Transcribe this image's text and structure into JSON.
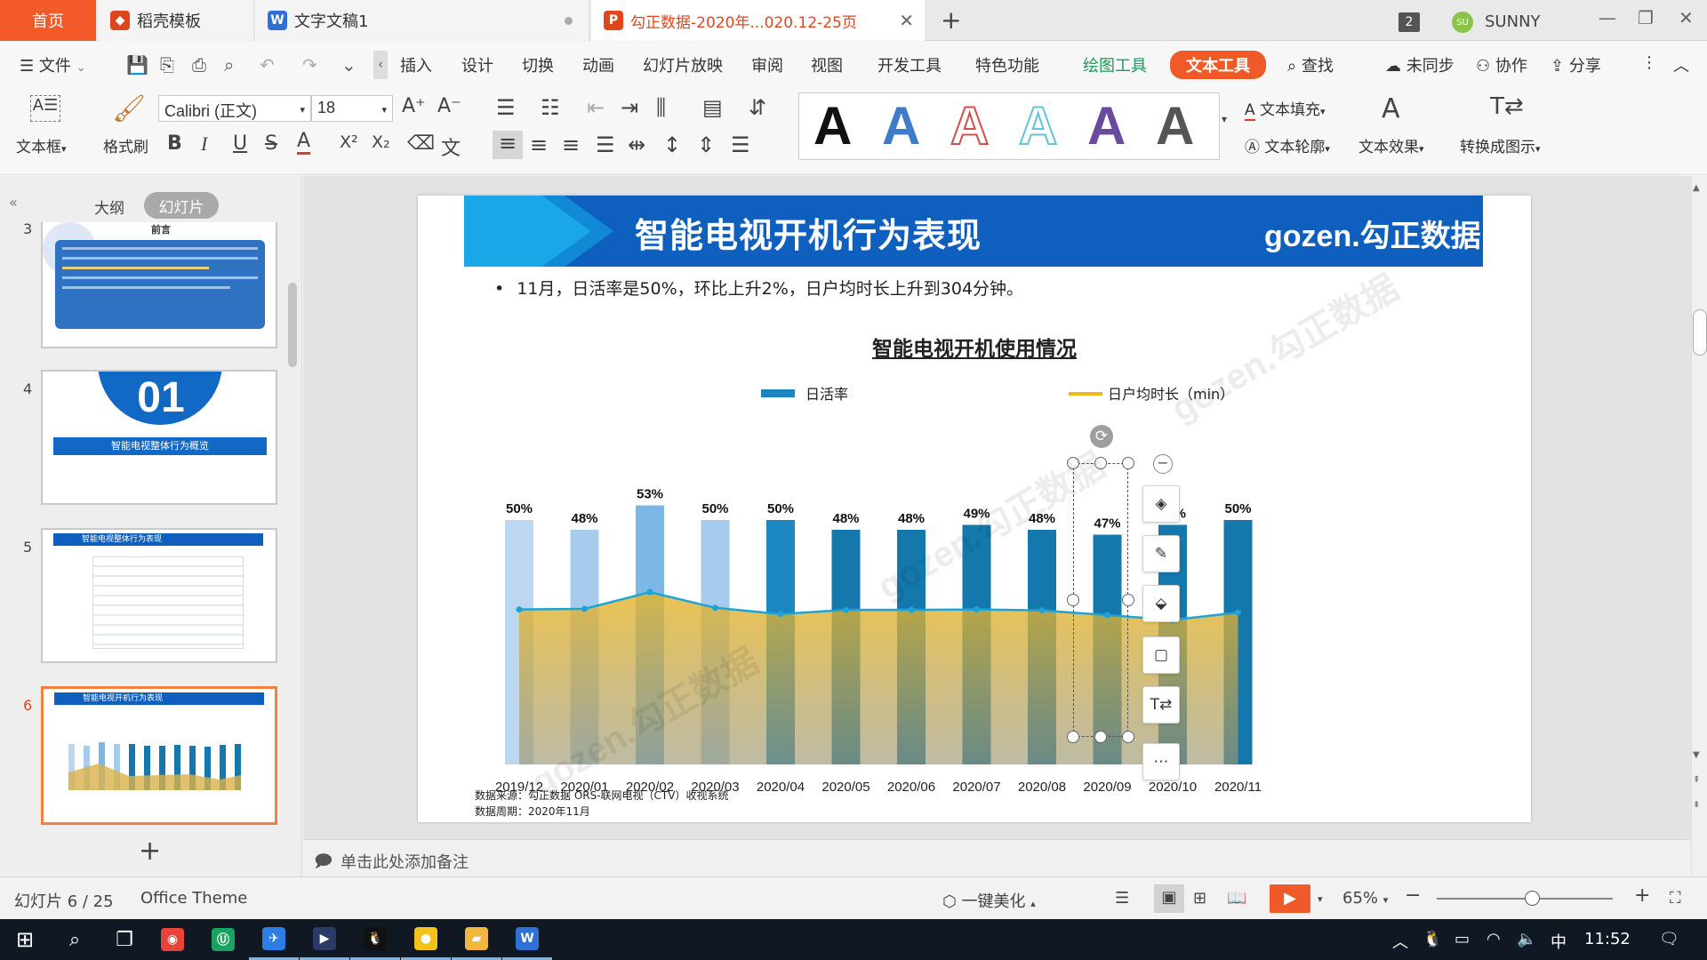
{
  "tabs": {
    "home": "首页",
    "items": [
      {
        "label": "稻壳模板",
        "icon": "daoke-icon",
        "color": "#e0461c"
      },
      {
        "label": "文字文稿1",
        "icon": "wps-writer-icon",
        "color": "#2f6fd6"
      },
      {
        "label": "勾正数据-2020年...020.12-25页",
        "icon": "wps-presentation-icon",
        "color": "#e0461c"
      }
    ],
    "new_tab": "+",
    "window_count": "2",
    "user_initials": "SU",
    "user_name": "SUNNY"
  },
  "menu": {
    "file": "文件",
    "items": [
      "插入",
      "设计",
      "切换",
      "动画",
      "幻灯片放映",
      "审阅",
      "视图",
      "开发工具",
      "特色功能"
    ],
    "drawing_tools": "绘图工具",
    "text_tools": "文本工具",
    "search": "查找",
    "unsynced": "未同步",
    "collaborate": "协作",
    "share": "分享"
  },
  "ribbon": {
    "textbox": "文本框",
    "format_painter": "格式刷",
    "font_name": "Calibri (正文)",
    "font_size": "18",
    "bold": "B",
    "italic": "I",
    "underline": "U",
    "strike": "S",
    "font_color": "A",
    "superscript": "X²",
    "subscript": "X₂",
    "text_fill": "文本填充",
    "text_outline": "文本轮廓",
    "text_effect": "文本效果",
    "convert_smartart": "转换成图示",
    "style_letter": "A",
    "style_colors": [
      "#111111",
      "#3d7cc8",
      "#d0504a",
      "#5fc6d6",
      "#6a4a9e",
      "#555555"
    ]
  },
  "left_panel": {
    "outline_tab": "大纲",
    "slides_tab": "幻灯片",
    "add_slide": "+",
    "thumbs": [
      {
        "num": "3",
        "title": "前言"
      },
      {
        "num": "4",
        "big": "01",
        "subtitle": "智能电视整体行为概览"
      },
      {
        "num": "5",
        "title": "智能电视整体行为表现"
      },
      {
        "num": "6",
        "title": "智能电视开机行为表现"
      }
    ]
  },
  "slide": {
    "title": "智能电视开机行为表现",
    "brand": "gozen.勾正数据",
    "bullet": "11月，日活率是50%，环比上升2%，日户均时长上升到304分钟。",
    "chart_title": "智能电视开机使用情况",
    "source_line1": "数据来源：勾正数据 ORS-联网电视（CTV）收视系统",
    "source_line2": "数据周期：2020年11月",
    "watermark": "gozen.勾正数据"
  },
  "chart_data": {
    "type": "bar",
    "title": "智能电视开机使用情况",
    "categories": [
      "2019/12",
      "2020/01",
      "2020/02",
      "2020/03",
      "2020/04",
      "2020/05",
      "2020/06",
      "2020/07",
      "2020/08",
      "2020/09",
      "2020/10",
      "2020/11"
    ],
    "series": [
      {
        "name": "日活率",
        "type": "bar",
        "values": [
          50,
          48,
          53,
          50,
          50,
          48,
          48,
          49,
          48,
          47,
          49,
          50
        ],
        "value_labels": [
          "50%",
          "48%",
          "53%",
          "50%",
          "50%",
          "48%",
          "48%",
          "49%",
          "48%",
          "47%",
          "49%",
          "50%"
        ]
      },
      {
        "name": "日户均时长（min）",
        "type": "area",
        "values": [
          296,
          297,
          329,
          299,
          287,
          295,
          295,
          296,
          294,
          285,
          276,
          290
        ]
      }
    ],
    "bar_colors": [
      "#bcd7ef",
      "#a7cbec",
      "#7db7e8",
      "#a7cbec",
      "#1c86c1",
      "#1578ad",
      "#1578ad",
      "#1578ad",
      "#1578ad",
      "#1578ad",
      "#1578ad",
      "#1578ad"
    ],
    "line_color": "#1ca3d8",
    "area_color": "#e8b526",
    "legend_position": "top",
    "bar_ylim": [
      0,
      60
    ],
    "area_ylim": [
      0,
      560
    ],
    "grid": false
  },
  "notes": {
    "placeholder": "单击此处添加备注"
  },
  "status": {
    "slide_info": "幻灯片 6 / 25",
    "theme": "Office Theme",
    "beautify": "一键美化",
    "zoom": "65%",
    "zoom_fraction": 0.54
  },
  "taskbar": {
    "time": "11:52",
    "ime": "中",
    "apps": [
      {
        "name": "chrome-icon",
        "color": "#e84337"
      },
      {
        "name": "green-app-icon",
        "color": "#1aa260"
      },
      {
        "name": "feishu-icon",
        "color": "#2f7de1"
      },
      {
        "name": "media-player-icon",
        "color": "#2b3a67"
      },
      {
        "name": "qq-icon",
        "color": "#111111"
      },
      {
        "name": "yellow-app-icon",
        "color": "#f3c21b"
      },
      {
        "name": "file-explorer-icon",
        "color": "#f2b73f"
      },
      {
        "name": "wps-icon",
        "color": "#2f6fd6"
      }
    ]
  }
}
